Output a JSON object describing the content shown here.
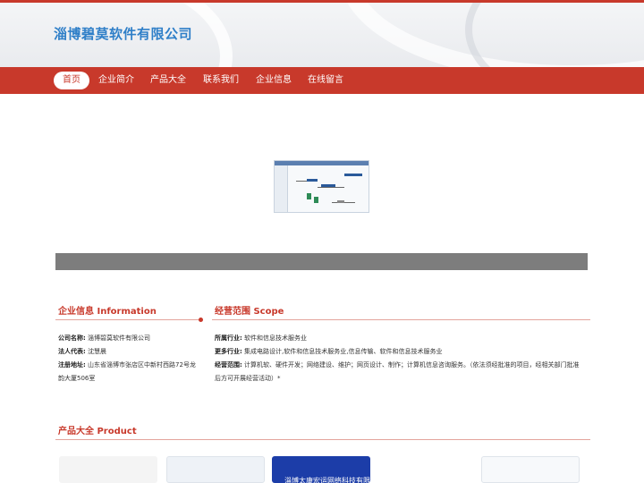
{
  "header": {
    "site_title": "淄博碧莫软件有限公司"
  },
  "nav": {
    "items": [
      {
        "label": "首页",
        "active": true
      },
      {
        "label": "企业简介",
        "active": false
      },
      {
        "label": "产品大全",
        "active": false
      },
      {
        "label": "联系我们",
        "active": false
      },
      {
        "label": "企业信息",
        "active": false
      },
      {
        "label": "在线留言",
        "active": false
      }
    ]
  },
  "company_info": {
    "title": "企业信息 Information",
    "rows": [
      {
        "label": "公司名称:",
        "value": "淄博碧莫软件有限公司"
      },
      {
        "label": "法人代表:",
        "value": "沈慧晨"
      },
      {
        "label": "注册地址:",
        "value": "山东省淄博市张店区中新村西路72号龙",
        "value_cont": "韵大厦506室"
      }
    ]
  },
  "scope": {
    "title": "经营范围 Scope",
    "rows": [
      {
        "label": "所属行业:",
        "value": "软件和信息技术服务业"
      },
      {
        "label": "更多行业:",
        "value": "集成电路设计,软件和信息技术服务业,信息传输、软件和信息技术服务业"
      },
      {
        "label": "经营范围:",
        "value": "计算机软、硬件开发；网络建设、维护；网页设计、制作；计算机信息咨询服务。（依法须经批准的项目，经相关部门批准",
        "value_cont": "后方可开展经营活动）*"
      }
    ]
  },
  "products": {
    "title": "产品大全 Product",
    "card3_text": "淄博太康宏运网络科技有限公"
  },
  "colors": {
    "brand_red": "#c8392b",
    "title_blue": "#2f7fc8",
    "band_gray": "#7d7d7d"
  }
}
